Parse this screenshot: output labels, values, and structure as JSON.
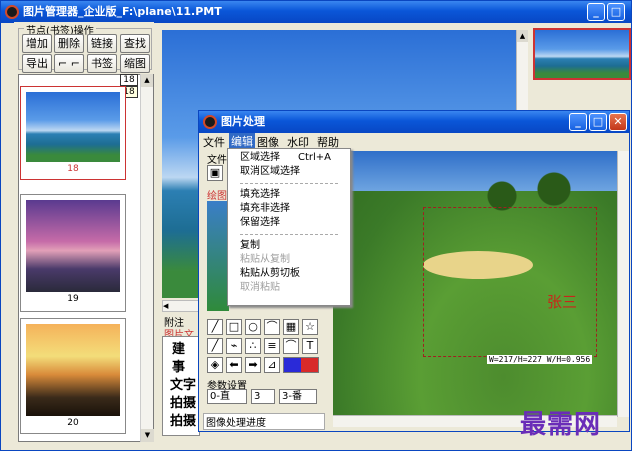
{
  "main": {
    "title": "图片管理器_企业版_F:\\plane\\11.PMT",
    "bookmark_group": "节点(书签)操作",
    "row1": [
      "增加",
      "删除",
      "链接",
      "查找"
    ],
    "row2": [
      "导出",
      "书签",
      "缩图"
    ],
    "page_badge": "18",
    "page_badge2": "18",
    "thumbs": [
      "18",
      "19",
      "20"
    ],
    "left_labels": [
      "附注",
      "图片文"
    ],
    "table_chars": [
      "建",
      "事",
      "文字",
      "拍摄",
      "拍摄"
    ]
  },
  "dialog": {
    "title": "图片处理",
    "menus": [
      "文件",
      "编辑",
      "图像",
      "水印",
      "帮助"
    ],
    "panel_label": "文件",
    "panel_label2": "绘图",
    "menu_items": [
      {
        "label": "区域选择",
        "shortcut": "Ctrl+A",
        "disabled": false
      },
      {
        "label": "取消区域选择",
        "shortcut": "",
        "disabled": false
      },
      {
        "sep": true
      },
      {
        "label": "填充选择",
        "shortcut": "",
        "disabled": false
      },
      {
        "label": "填充非选择",
        "shortcut": "",
        "disabled": false
      },
      {
        "label": "保留选择",
        "shortcut": "",
        "disabled": false
      },
      {
        "sep": true
      },
      {
        "label": "复制",
        "shortcut": "",
        "disabled": false
      },
      {
        "label": "粘贴从复制",
        "shortcut": "",
        "disabled": true
      },
      {
        "label": "粘贴从剪切板",
        "shortcut": "",
        "disabled": false
      },
      {
        "label": "取消粘贴",
        "shortcut": "",
        "disabled": true
      }
    ],
    "params_label": "参数设置",
    "select1": "0-直",
    "select2": "3",
    "select3": "3-番",
    "progress_label": "图像处理进度",
    "annotation": "张三",
    "coords": "W=217/H=227 W/H=0.956"
  },
  "watermark": "最需网"
}
